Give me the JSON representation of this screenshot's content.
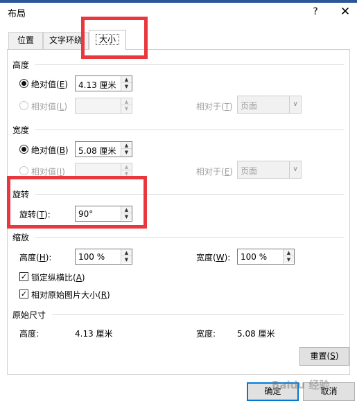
{
  "window": {
    "title": "布局",
    "help": "?",
    "close": "✕"
  },
  "tabs": [
    {
      "label": "位置",
      "selected": false
    },
    {
      "label": "文字环绕",
      "selected": false
    },
    {
      "label": "大小",
      "selected": true
    }
  ],
  "height": {
    "title": "高度",
    "absolute_label": "绝对值(",
    "absolute_key": "E",
    "absolute_value": "4.13 厘米",
    "relative_label": "相对值(",
    "relative_key": "L",
    "relative_to_label": "相对于(",
    "relative_to_key": "T",
    "relative_to_value": "页面"
  },
  "width": {
    "title": "宽度",
    "absolute_label": "绝对值(",
    "absolute_key": "B",
    "absolute_value": "5.08 厘米",
    "relative_label": "相对值(",
    "relative_key": "I",
    "relative_to_label": "相对于(",
    "relative_to_key": "E",
    "relative_to_value": "页面"
  },
  "rotate": {
    "title": "旋转",
    "label": "旋转(",
    "key": "T",
    "value": "90°"
  },
  "scale": {
    "title": "缩放",
    "height_label": "高度(",
    "height_key": "H",
    "height_value": "100 %",
    "width_label": "宽度(",
    "width_key": "W",
    "width_value": "100 %",
    "lock_label": "锁定纵横比(",
    "lock_key": "A",
    "relative_label": "相对原始图片大小(",
    "relative_key": "R"
  },
  "original": {
    "title": "原始尺寸",
    "height_label": "高度:",
    "height_value": "4.13 厘米",
    "width_label": "宽度:",
    "width_value": "5.08 厘米"
  },
  "buttons": {
    "reset": "重置(",
    "reset_key": "S",
    "ok": "确定",
    "cancel": "取消"
  },
  "icons": {
    "up": "▲",
    "down": "▼",
    "dropdown": "∨",
    "check": "✓"
  },
  "watermark": "Baidu 经验",
  "colors": {
    "highlight": "#e8383d",
    "focus": "#0078d7"
  }
}
